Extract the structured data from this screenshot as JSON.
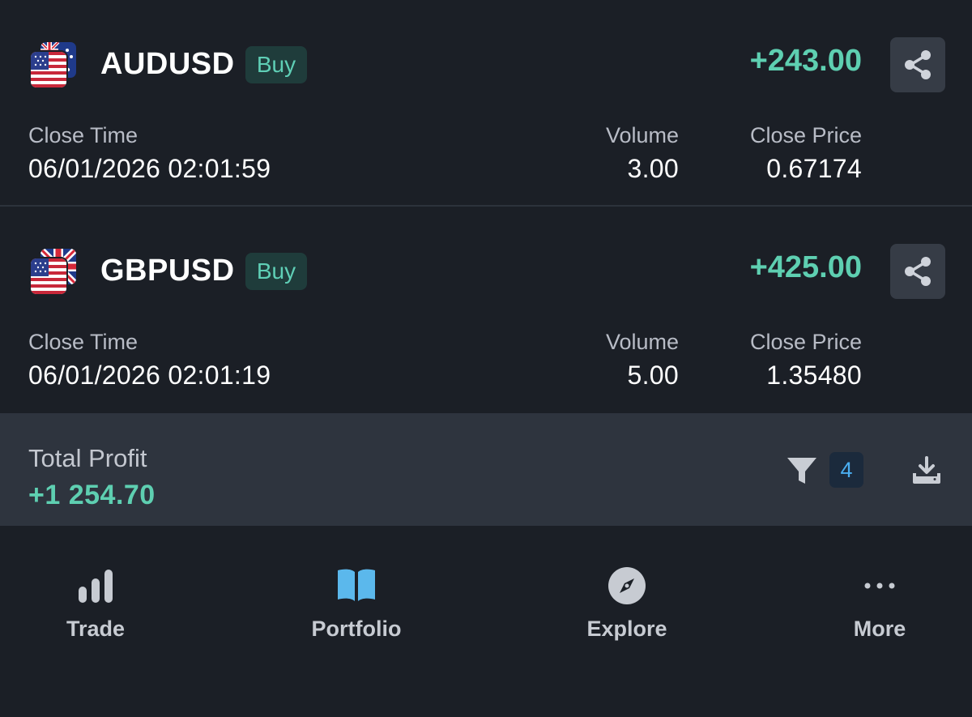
{
  "trades": [
    {
      "symbol": "AUDUSD",
      "side": "Buy",
      "profit": "+243.00",
      "flags": [
        "australia-flag",
        "united-states-flag"
      ],
      "close_time_label": "Close Time",
      "close_time": "06/01/2026 02:01:59",
      "volume_label": "Volume",
      "volume": "3.00",
      "close_price_label": "Close Price",
      "close_price": "0.67174"
    },
    {
      "symbol": "GBPUSD",
      "side": "Buy",
      "profit": "+425.00",
      "flags": [
        "united-kingdom-flag",
        "united-states-flag"
      ],
      "close_time_label": "Close Time",
      "close_time": "06/01/2026 02:01:19",
      "volume_label": "Volume",
      "volume": "5.00",
      "close_price_label": "Close Price",
      "close_price": "1.35480"
    }
  ],
  "summary": {
    "total_label": "Total Profit",
    "total_value": "+1 254.70",
    "filter_count": "4",
    "filter_icon": "filter-icon",
    "download_icon": "download-icon"
  },
  "nav": [
    {
      "label": "Trade",
      "icon": "bar-chart-icon",
      "active": false
    },
    {
      "label": "Portfolio",
      "icon": "book-icon",
      "active": true
    },
    {
      "label": "Explore",
      "icon": "compass-icon",
      "active": false
    },
    {
      "label": "More",
      "icon": "more-icon",
      "active": false
    }
  ],
  "colors": {
    "background": "#1b1f26",
    "profit_green": "#5ecfb1",
    "buy_badge_bg": "#1f3c3b",
    "summary_bg": "#2e343e",
    "accent_blue": "#4aaef0",
    "portfolio_icon": "#5bb8ec"
  }
}
